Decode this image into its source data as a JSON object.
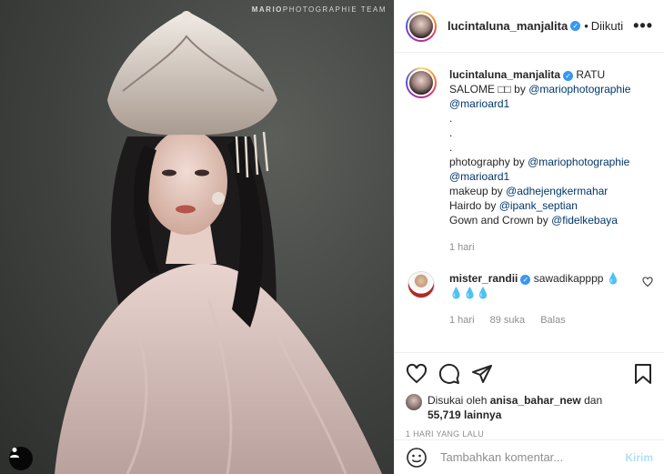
{
  "photo": {
    "watermark_bold": "MARIO",
    "watermark_rest": "PHOTOGRAPHIE TEAM",
    "user_tag_icon": "person-icon"
  },
  "header": {
    "username": "lucintaluna_manjalita",
    "dot": "•",
    "follow_label": "Diikuti",
    "more_label": "•••"
  },
  "caption": {
    "username": "lucintaluna_manjalita",
    "lines": {
      "l1_text": " RATU SALOME □□ by ",
      "l1_mention": "@mariophotographie",
      "l2_mention": "@marioard1",
      "dot1": ".",
      "dot2": ".",
      "dot3": ".",
      "l3_text": "photography by ",
      "l3_mention": "@mariophotographie",
      "l4_mention": "@marioard1",
      "l5_text": "makeup by ",
      "l5_mention": "@adhejengkermahar",
      "l6_text": "Hairdo by ",
      "l6_mention": "@ipank_septian",
      "l7_text": "Gown and Crown by ",
      "l7_mention": "@fidelkebaya"
    },
    "time": "1 hari"
  },
  "comment": {
    "username": "mister_randii",
    "text": " sawadikapppp 💧 💧💧💧",
    "time": "1 hari",
    "likes": "89 suka",
    "reply": "Balas"
  },
  "actions": {
    "liked_by_prefix": "Disukai oleh ",
    "liked_by_user": "anisa_bahar_new",
    "liked_by_mid": " dan",
    "liked_count": "55,719 lainnya",
    "ago": "1 HARI YANG LALU"
  },
  "add_comment": {
    "placeholder": "Tambahkan komentar...",
    "post_label": "Kirim"
  },
  "colors": {
    "verified": "#3897f0",
    "mention": "#00376b",
    "muted": "#8e8e8e",
    "post_disabled": "#b2dffc"
  }
}
